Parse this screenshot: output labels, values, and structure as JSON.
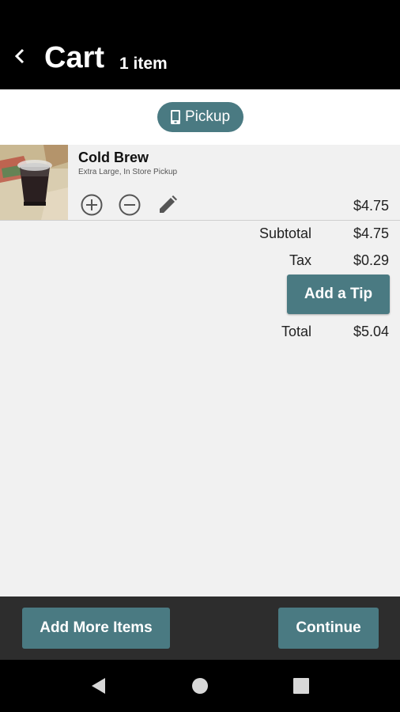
{
  "header": {
    "title": "Cart",
    "item_count": "1 item",
    "back_icon": "chevron-left-icon"
  },
  "pickup": {
    "label": "Pickup",
    "icon": "phone-icon"
  },
  "item": {
    "name": "Cold Brew",
    "description": "Extra Large, In Store Pickup",
    "price": "$4.75",
    "controls": {
      "add_icon": "plus-circle-icon",
      "remove_icon": "minus-circle-icon",
      "edit_icon": "pencil-icon"
    }
  },
  "summary": {
    "subtotal_label": "Subtotal",
    "subtotal_value": "$4.75",
    "tax_label": "Tax",
    "tax_value": "$0.29",
    "tip_button": "Add a Tip",
    "total_label": "Total",
    "total_value": "$5.04"
  },
  "actions": {
    "add_more": "Add More Items",
    "continue": "Continue"
  },
  "colors": {
    "accent": "#4a7a82",
    "header_bg": "#000000",
    "page_bg": "#f1f1f1",
    "action_bar_bg": "#2d2d2d"
  }
}
